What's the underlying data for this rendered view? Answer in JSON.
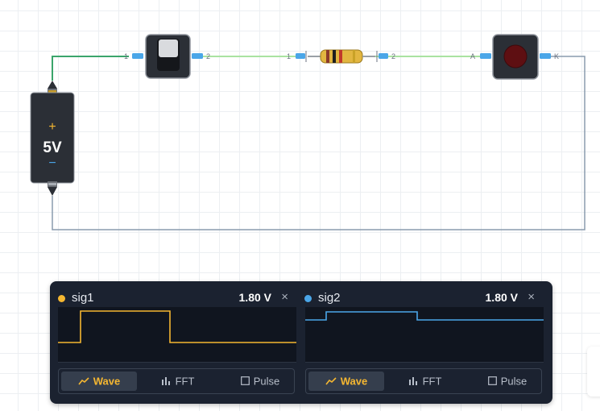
{
  "colors": {
    "wire_green": "#3aa56b",
    "wire_light": "#a9e3a1",
    "wire_gray": "#8a9bad",
    "pin_blue": "#4aa6e8",
    "battery_plus": "#f5b731",
    "battery_minus": "#4aa6e8",
    "sig1": "#f5b731",
    "sig2": "#4aa6e8",
    "led_off": "#5e0f12",
    "panel_bg": "#1b2230"
  },
  "circuit": {
    "battery": {
      "voltage_label": "5V",
      "plus_symbol": "+",
      "minus_symbol": "−"
    },
    "switch": {
      "pin1": "1",
      "pin2": "2",
      "icon": "toggle-switch-icon"
    },
    "resistor": {
      "pin1": "1",
      "pin2": "2"
    },
    "led": {
      "pin_anode": "A",
      "pin_cathode": "K"
    }
  },
  "scope": {
    "channels": [
      {
        "name": "sig1",
        "value": "1.80 V",
        "close": "×",
        "color": "#f5b731",
        "waveform_levels": [
          0,
          1,
          0
        ],
        "tabs": [
          {
            "label": "Wave",
            "icon": "wave-icon",
            "active": true
          },
          {
            "label": "FFT",
            "icon": "fft-bars-icon",
            "active": false
          },
          {
            "label": "Pulse",
            "icon": "pulse-checkbox-icon",
            "active": false
          }
        ]
      },
      {
        "name": "sig2",
        "value": "1.80 V",
        "close": "×",
        "color": "#4aa6e8",
        "waveform_levels": [
          0,
          1,
          0
        ],
        "tabs": [
          {
            "label": "Wave",
            "icon": "wave-icon",
            "active": true
          },
          {
            "label": "FFT",
            "icon": "fft-bars-icon",
            "active": false
          },
          {
            "label": "Pulse",
            "icon": "pulse-checkbox-icon",
            "active": false
          }
        ]
      }
    ]
  }
}
